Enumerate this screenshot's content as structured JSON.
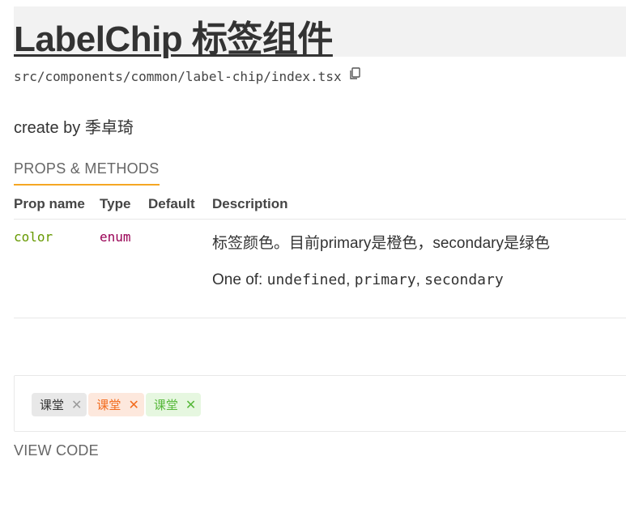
{
  "header": {
    "title": "LabelChip 标签组件",
    "file_path": "src/components/common/label-chip/index.tsx",
    "copy_icon": "copy-icon"
  },
  "description": "create by 季卓琦",
  "tabs": [
    {
      "label": "PROPS & METHODS",
      "active": true
    }
  ],
  "props_table": {
    "columns": [
      "Prop name",
      "Type",
      "Default",
      "Description"
    ],
    "rows": [
      {
        "name": "color",
        "type": "enum",
        "default": "",
        "description": "标签颜色。目前primary是橙色，secondary是绿色",
        "one_of_label": "One of:",
        "options": [
          "undefined",
          "primary",
          "secondary"
        ]
      }
    ]
  },
  "demo": {
    "chips": [
      {
        "label": "课堂",
        "variant": "default",
        "close_icon": "close-icon",
        "close_glyph": "✕"
      },
      {
        "label": "课堂",
        "variant": "primary",
        "close_icon": "close-icon",
        "close_glyph": "✕"
      },
      {
        "label": "课堂",
        "variant": "secondary",
        "close_icon": "close-icon",
        "close_glyph": "✕"
      }
    ]
  },
  "view_code_label": "VIEW CODE",
  "colors": {
    "accent_tab_underline": "#f5a623",
    "prop_name": "#669900",
    "prop_type": "#990055",
    "chip_primary": "#f26b1d",
    "chip_secondary": "#56b83a"
  }
}
